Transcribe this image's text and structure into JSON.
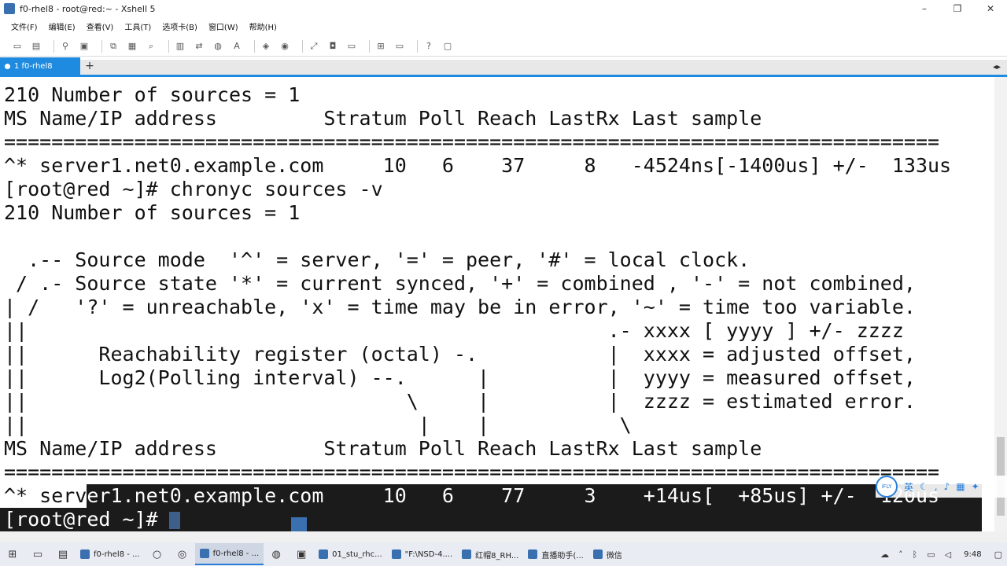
{
  "window": {
    "title": "f0-rhel8 - root@red:~ - Xshell 5",
    "controls": [
      "–",
      "❐",
      "✕"
    ]
  },
  "menu": [
    "文件(F)",
    "编辑(E)",
    "查看(V)",
    "工具(T)",
    "选项卡(B)",
    "窗口(W)",
    "帮助(H)"
  ],
  "toolbar_icons": [
    "new-session-icon",
    "open-folder-icon",
    "connect-icon",
    "properties-icon",
    "copy-icon",
    "paste-icon",
    "find-icon",
    "print-icon",
    "transfer-icon",
    "globe-icon",
    "font-icon",
    "script-icon",
    "keyboard-icon",
    "fullscreen-icon",
    "lock-icon",
    "compose-icon",
    "add-icon",
    "layout-icon",
    "help-icon",
    "chat-icon"
  ],
  "tab": {
    "label": "1 f0-rhel8",
    "add": "+"
  },
  "terminal": {
    "lines": [
      "210 Number of sources = 1",
      "MS Name/IP address         Stratum Poll Reach LastRx Last sample",
      "===============================================================================",
      "^* server1.net0.example.com     10   6    37     8   -4524ns[-1400us] +/-  133us",
      "[root@red ~]# chronyc sources -v",
      "210 Number of sources = 1",
      "",
      "  .-- Source mode  '^' = server, '=' = peer, '#' = local clock.",
      " / .- Source state '*' = current synced, '+' = combined , '-' = not combined,",
      "| /   '?' = unreachable, 'x' = time may be in error, '~' = time too variable.",
      "||                                                 .- xxxx [ yyyy ] +/- zzzz",
      "||      Reachability register (octal) -.           |  xxxx = adjusted offset,",
      "||      Log2(Polling interval) --.      |          |  yyyy = measured offset,",
      "||                                \\     |          |  zzzz = estimated error.",
      "||                                 |    |           \\",
      "MS Name/IP address         Stratum Poll Reach LastRx Last sample",
      "===============================================================================",
      "^* server1.net0.example.com     10   6    77     3    +14us[  +85us] +/-  120us",
      "[root@red ~]# "
    ]
  },
  "ime": {
    "logo": "iFLY",
    "lang": "英",
    "icons": [
      "moon-icon",
      "comma-icon",
      "microphone-icon",
      "keyboard-icon",
      "shirt-icon"
    ]
  },
  "taskbar": {
    "apps": [
      {
        "label": "f0-rhel8 - ...",
        "active": false
      },
      {
        "label": "f0-rhel8 - ...",
        "active": true
      },
      {
        "label": "01_stu_rhc...",
        "active": false
      },
      {
        "label": "\"F:\\NSD-4....",
        "active": false
      },
      {
        "label": "红帽8_RH...",
        "active": false
      },
      {
        "label": "直播助手(...",
        "active": false
      },
      {
        "label": "微信",
        "active": false
      }
    ],
    "clock": "9:48"
  }
}
